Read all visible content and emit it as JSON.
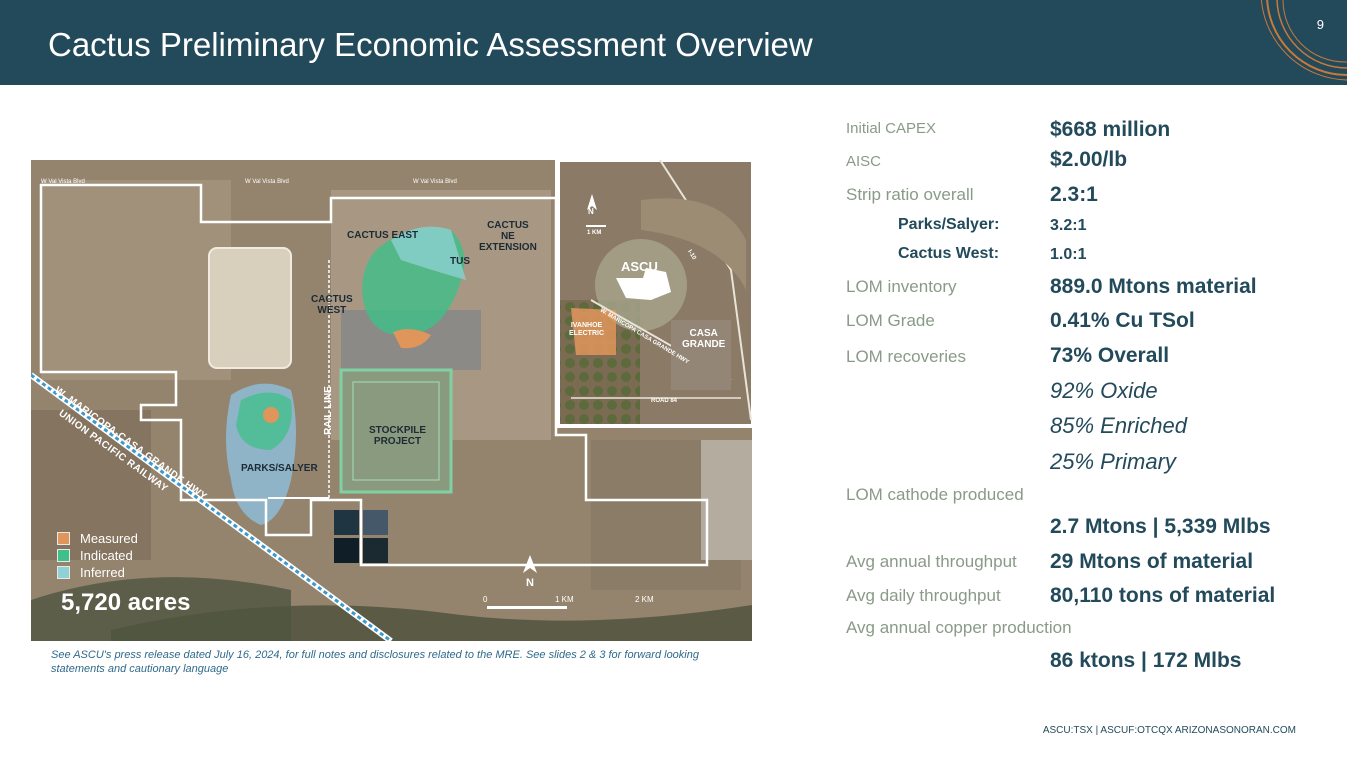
{
  "header": {
    "title": "Cactus Preliminary Economic Assessment Overview",
    "page_number": "9",
    "accent_color": "#c8793a",
    "background_color": "#234a5b"
  },
  "map": {
    "labels": {
      "cactus_east": "CACTUS EAST",
      "cactus_ne_extension": "CACTUS\nNE\nEXTENSION",
      "cactus_west": "CACTUS\nWEST",
      "rail_line": "RAIL LINE",
      "stockpile_project": "STOCKPILE\nPROJECT",
      "parks_salyer": "PARKS/SALYER",
      "highway": "W. MARICOPA-CASA GRANDE HWY",
      "railway": "UNION PACIFIC RAILWAY",
      "road_1": "W Val Vista Blvd",
      "road_2": "W Val Vista Blvd",
      "road_3": "W Val Vista Blvd",
      "partial_tus": "TUS"
    },
    "inset": {
      "ascu": "ASCU",
      "ivanhoe": "IVANHOE\nELECTRIC",
      "casa_grande": "CASA\nGRANDE",
      "north": "N",
      "scale": "1 KM",
      "highway": "W. MARICOPA CASA GRANDE HWY",
      "interstate": "I-10",
      "road": "ROAD 84"
    },
    "legend": [
      {
        "label": "Measured",
        "color": "#e0955a"
      },
      {
        "label": "Indicated",
        "color": "#3fbf8a"
      },
      {
        "label": "Inferred",
        "color": "#8fd2d6"
      }
    ],
    "acres": "5,720 acres",
    "north_label": "N",
    "scale_labels": [
      "0",
      "1 KM",
      "2 KM"
    ]
  },
  "footnote": "See ASCU's press release dated July 16, 2024, for full notes and disclosures related to the MRE. See slides 2 & 3 for forward looking statements and cautionary language",
  "stats": {
    "initial_capex": {
      "label": "Initial CAPEX",
      "value": "$668 million"
    },
    "aisc": {
      "label": "AISC",
      "value": "$2.00/lb"
    },
    "strip_ratio": {
      "label": "Strip ratio overall",
      "value": "2.3:1"
    },
    "parks_salyer": {
      "label": "Parks/Salyer:",
      "value": "3.2:1"
    },
    "cactus_west": {
      "label": "Cactus West:",
      "value": "1.0:1"
    },
    "lom_inventory": {
      "label": "LOM inventory",
      "value": "889.0 Mtons material"
    },
    "lom_grade": {
      "label": "LOM Grade",
      "value": "0.41% Cu TSol"
    },
    "lom_recoveries": {
      "label": "LOM recoveries",
      "value": "73% Overall"
    },
    "recovery_oxide": "92% Oxide",
    "recovery_enriched": "85% Enriched",
    "recovery_primary": "25% Primary",
    "lom_cathode": {
      "label": "LOM cathode produced",
      "value": "2.7 Mtons | 5,339 Mlbs"
    },
    "annual_throughput": {
      "label": "Avg annual throughput",
      "value": "29 Mtons of material"
    },
    "daily_throughput": {
      "label": "Avg daily throughput",
      "value": "80,110 tons of material"
    },
    "annual_copper": {
      "label": "Avg annual copper production",
      "value": "86 ktons | 172 Mlbs"
    }
  },
  "footer": "ASCU:TSX | ASCUF:OTCQX   ARIZONASONORAN.COM"
}
